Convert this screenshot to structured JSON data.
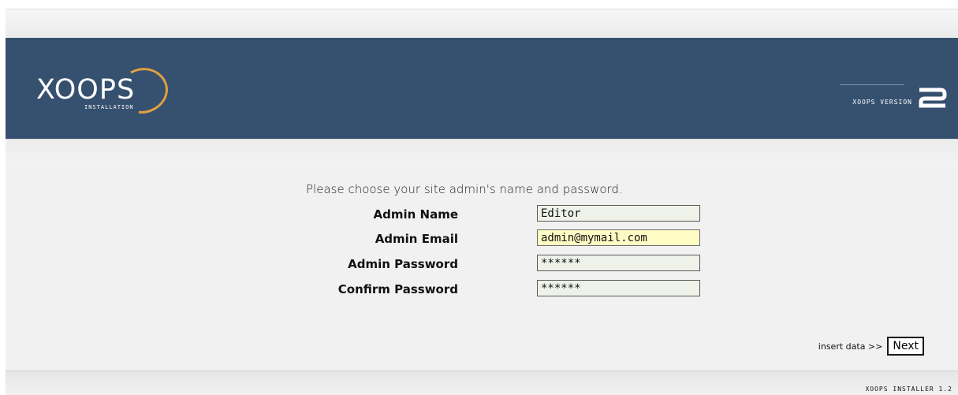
{
  "header": {
    "logo_text": "XOOPS",
    "logo_sub": "INSTALLATION",
    "version_label": "XOOPS VERSION",
    "version_number": "2"
  },
  "form": {
    "intro": "Please choose your site admin's name and password.",
    "fields": [
      {
        "label": "Admin Name",
        "value": "Editor"
      },
      {
        "label": "Admin Email",
        "value": "admin@mymail.com"
      },
      {
        "label": "Admin Password",
        "value": "******"
      },
      {
        "label": "Confirm Password",
        "value": "******"
      }
    ]
  },
  "actions": {
    "insert_label": "insert data >>",
    "next_label": "Next"
  },
  "footer": {
    "text": "XOOPS INSTALLER 1.2"
  },
  "colors": {
    "header_bg": "#36506f",
    "page_bg": "#f1f1f1",
    "field_bg": "#eef2e8",
    "focused_field_bg": "#fffbc4"
  }
}
